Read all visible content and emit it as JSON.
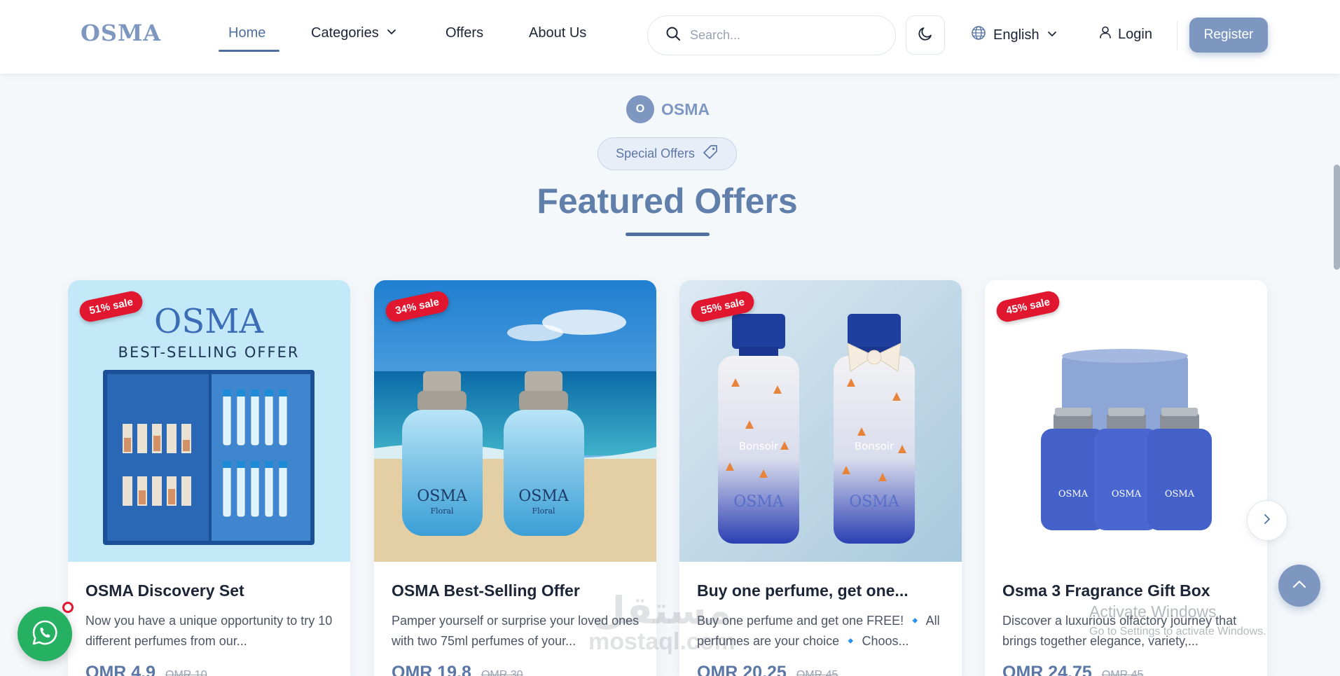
{
  "nav": {
    "logo": "OSMA",
    "links": [
      {
        "label": "Home",
        "active": true
      },
      {
        "label": "Categories",
        "has_dropdown": true
      },
      {
        "label": "Offers"
      },
      {
        "label": "About Us"
      }
    ],
    "search_placeholder": "Search...",
    "theme_icon": "moon-icon",
    "language": "English",
    "login_label": "Login",
    "register_label": "Register"
  },
  "section": {
    "brand_badge": "O",
    "brand_name": "OSMA",
    "pill_label": "Special Offers",
    "title": "Featured Offers"
  },
  "cards": [
    {
      "badge": "51% sale",
      "image_text": [
        "OSMA",
        "BEST-SELLING OFFER"
      ],
      "title": "OSMA Discovery Set",
      "description": "Now you have a unique opportunity to try 10 different perfumes from our...",
      "price": "OMR 4.9",
      "old_price": "OMR 10"
    },
    {
      "badge": "34% sale",
      "image_text": [
        "OSMA",
        "Floral"
      ],
      "title": "OSMA Best-Selling Offer",
      "description": "Pamper yourself or surprise your loved ones with two 75ml perfumes of your...",
      "price": "OMR 19.8",
      "old_price": "OMR 30"
    },
    {
      "badge": "55% sale",
      "image_text": [
        "Bonsoir",
        "OSMA"
      ],
      "title": "Buy one perfume, get one...",
      "description": "Buy one perfume and get one FREE! 🔹 All perfumes are your choice 🔹 Choos...",
      "price": "OMR 20.25",
      "old_price": "OMR 45"
    },
    {
      "badge": "45% sale",
      "image_text": [
        "OSMA"
      ],
      "title": "Osma 3 Fragrance Gift Box",
      "description": "Discover a luxurious olfactory journey that brings together elegance, variety,...",
      "price": "OMR 24.75",
      "old_price": "OMR 45"
    }
  ],
  "overlays": {
    "activate_title": "Activate Windows",
    "activate_sub": "Go to Settings to activate Windows.",
    "watermark_ar": "مستقل",
    "watermark_en": "mostaql.com"
  },
  "colors": {
    "accent": "#7e97c1",
    "accent_dark": "#4e6fa0",
    "sale_red": "#e0172f",
    "whatsapp_green": "#25b062"
  }
}
